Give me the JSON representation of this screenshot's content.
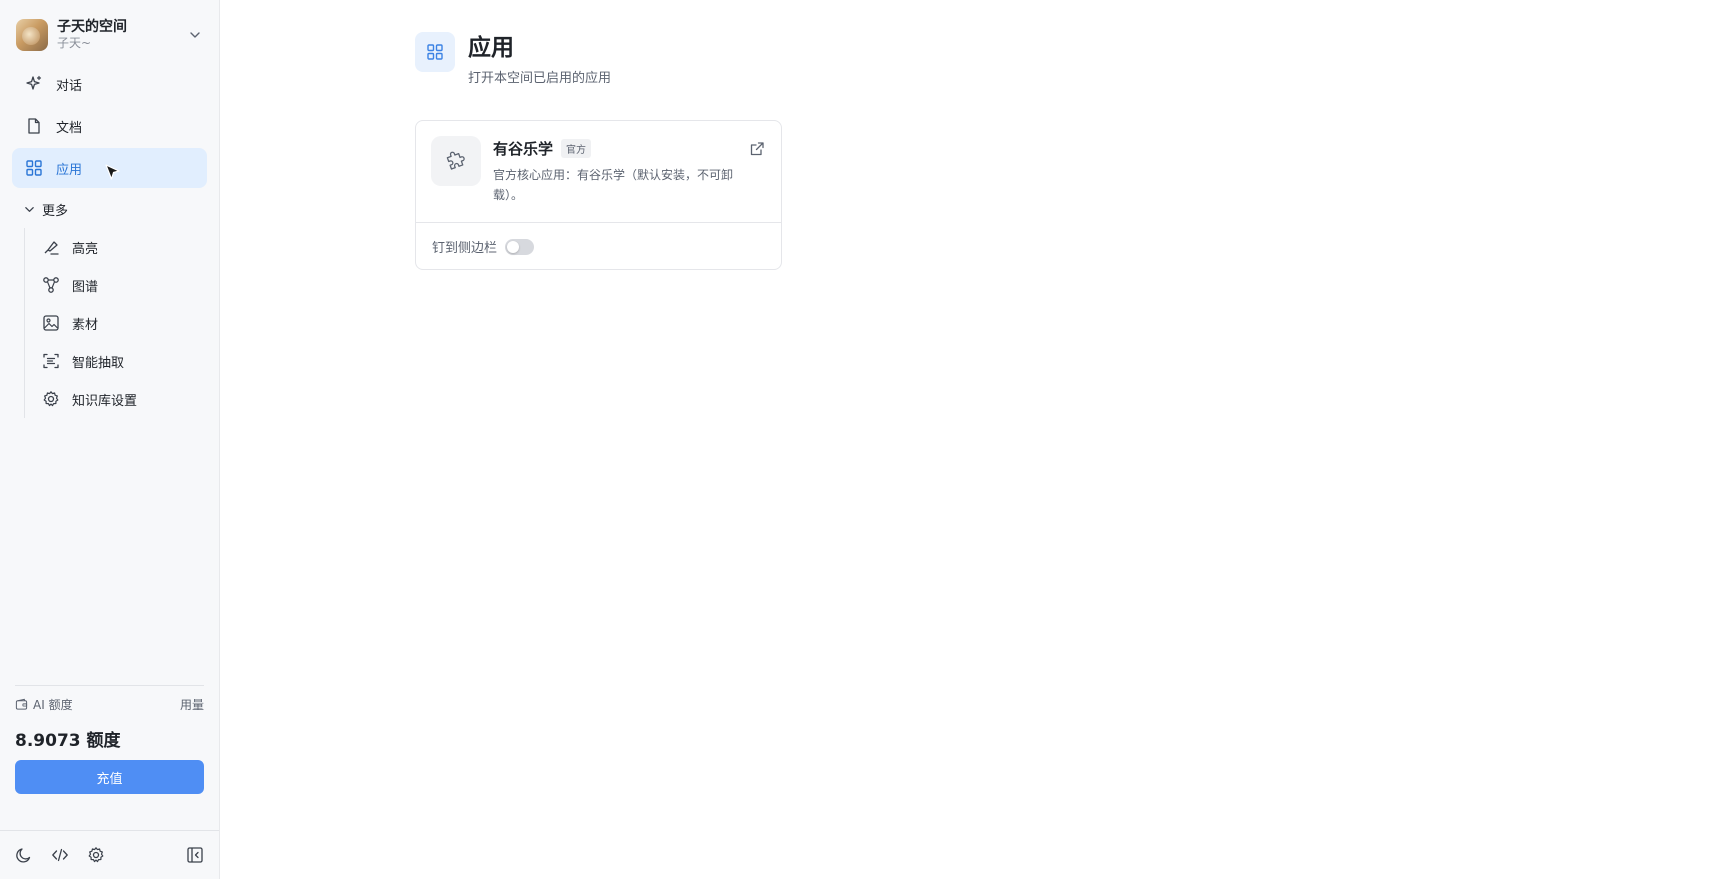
{
  "workspace": {
    "name": "子天的空间",
    "user": "子天~"
  },
  "nav": [
    {
      "label": "对话",
      "icon": "sparkle-icon"
    },
    {
      "label": "文档",
      "icon": "file-icon"
    },
    {
      "label": "应用",
      "icon": "grid-icon",
      "active": true
    }
  ],
  "more": {
    "label": "更多",
    "items": [
      {
        "label": "高亮",
        "icon": "highlighter-icon"
      },
      {
        "label": "图谱",
        "icon": "graph-icon"
      },
      {
        "label": "素材",
        "icon": "image-icon"
      },
      {
        "label": "智能抽取",
        "icon": "scan-text-icon"
      },
      {
        "label": "知识库设置",
        "icon": "gear-icon"
      }
    ]
  },
  "credit": {
    "label": "AI 额度",
    "usage_link": "用量",
    "amount": "8.9073 额度",
    "recharge_label": "充值"
  },
  "page": {
    "title": "应用",
    "subtitle": "打开本空间已启用的应用"
  },
  "app_card": {
    "title": "有谷乐学",
    "badge": "官方",
    "description": "官方核心应用：有谷乐学（默认安装，不可卸载）。",
    "pin_label": "钉到侧边栏",
    "pinned": false
  },
  "colors": {
    "accent": "#2a75d6",
    "active_bg": "#e1eefe",
    "button": "#4f8ef4"
  }
}
